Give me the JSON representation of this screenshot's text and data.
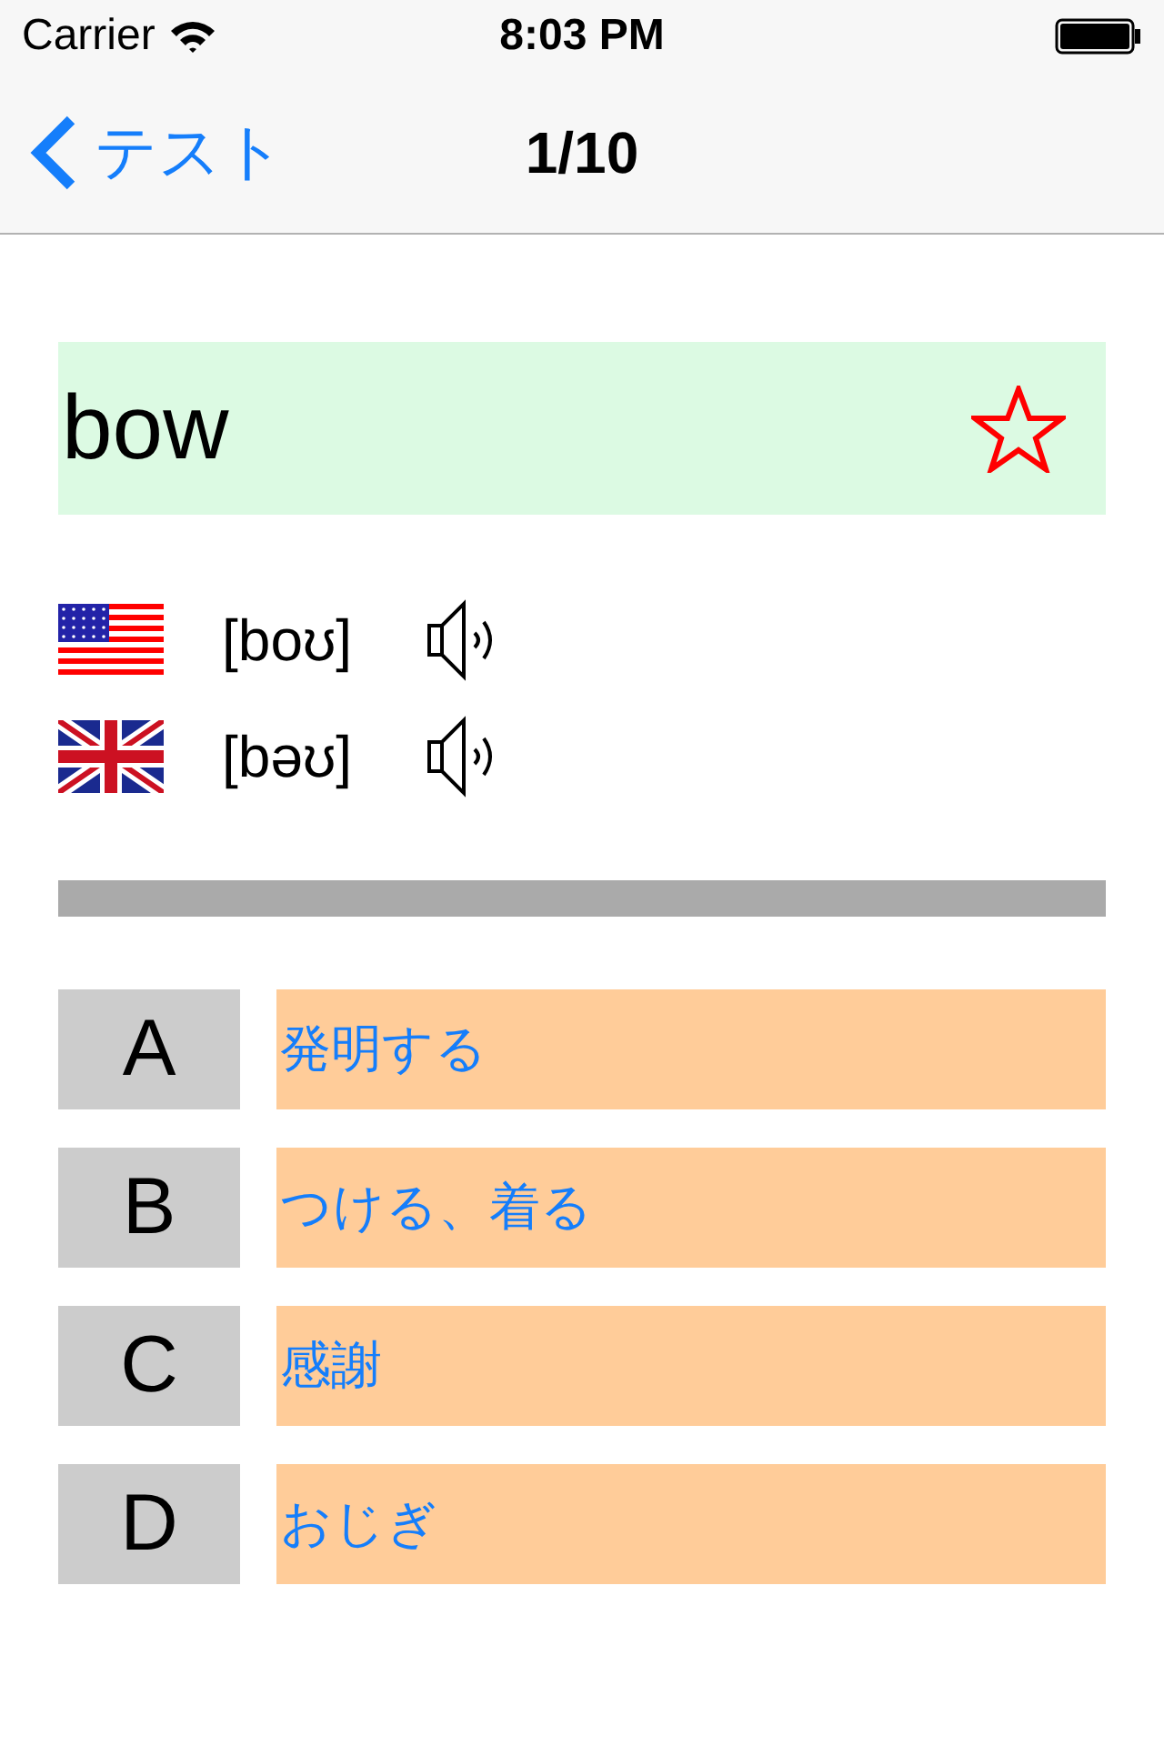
{
  "status_bar": {
    "carrier": "Carrier",
    "time": "8:03 PM"
  },
  "nav": {
    "back": "テスト",
    "title": "1/10"
  },
  "word": {
    "text": "bow",
    "favorite": false
  },
  "pronunciations": [
    {
      "kind": "us",
      "ipa": "[boʊ]"
    },
    {
      "kind": "uk",
      "ipa": "[bəʊ]"
    }
  ],
  "choices": [
    {
      "letter": "A",
      "text": "発明する"
    },
    {
      "letter": "B",
      "text": "つける、着る"
    },
    {
      "letter": "C",
      "text": "感謝"
    },
    {
      "letter": "D",
      "text": "おじぎ"
    }
  ]
}
